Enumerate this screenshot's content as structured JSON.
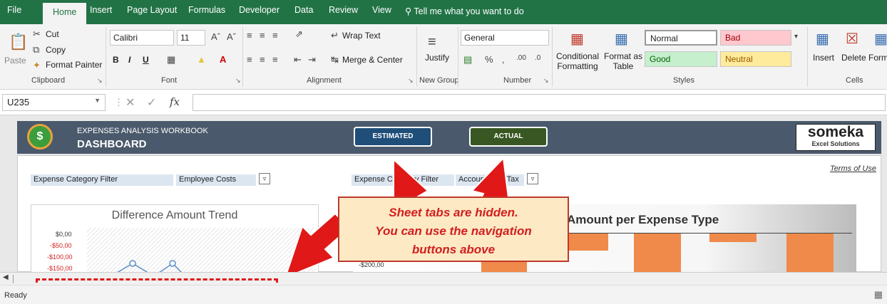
{
  "ribbon_tabs": [
    "File",
    "Home",
    "Insert",
    "Page Layout",
    "Formulas",
    "Developer",
    "Data",
    "Review",
    "View"
  ],
  "tell_me": "Tell me what you want to do",
  "clipboard": {
    "paste": "Paste",
    "cut": "Cut",
    "copy": "Copy",
    "format_painter": "Format Painter",
    "label": "Clipboard"
  },
  "font": {
    "name": "Calibri",
    "size": "11",
    "bold": "B",
    "italic": "I",
    "underline": "U",
    "label": "Font"
  },
  "alignment": {
    "wrap": "Wrap Text",
    "merge": "Merge & Center",
    "label": "Alignment"
  },
  "new_group": {
    "justify": "Justify",
    "label": "New Group"
  },
  "number": {
    "format": "General",
    "label": "Number"
  },
  "styles": {
    "cond_format": "Conditional Formatting",
    "format_table": "Format as Table",
    "normal": "Normal",
    "bad": "Bad",
    "good": "Good",
    "neutral": "Neutral",
    "label": "Styles"
  },
  "cells": {
    "insert": "Insert",
    "delete": "Delete",
    "format": "Form",
    "label": "Cells"
  },
  "formula_bar": {
    "cell_ref": "U235",
    "fx": "fx",
    "value": ""
  },
  "dashboard": {
    "subtitle": "EXPENSES ANALYSIS WORKBOOK",
    "title": "DASHBOARD",
    "btn_estimated": "ESTIMATED",
    "btn_actual": "ACTUAL",
    "logo_big": "someka",
    "logo_small": "Excel Solutions",
    "terms": "Terms of Use",
    "filter1_label": "Expense Category Filter",
    "filter1_value": "Employee Costs",
    "filter2_label": "Expense Category Filter",
    "filter2_value": "Accounting & Tax"
  },
  "chart1": {
    "title": "Difference Amount Trend",
    "ticks": [
      "$0,00",
      "-$50,00",
      "-$100,00",
      "-$150,00"
    ]
  },
  "chart2": {
    "title": "Amount per Expense Type",
    "tick": "-$200,00"
  },
  "callout": {
    "line1": "Sheet tabs are hidden.",
    "line2": "You can use the navigation",
    "line3": "buttons above"
  },
  "status": "Ready",
  "colors": {
    "excel_green": "#217346",
    "header_bg": "#4a5a6c",
    "arrow_red": "#e01818"
  }
}
